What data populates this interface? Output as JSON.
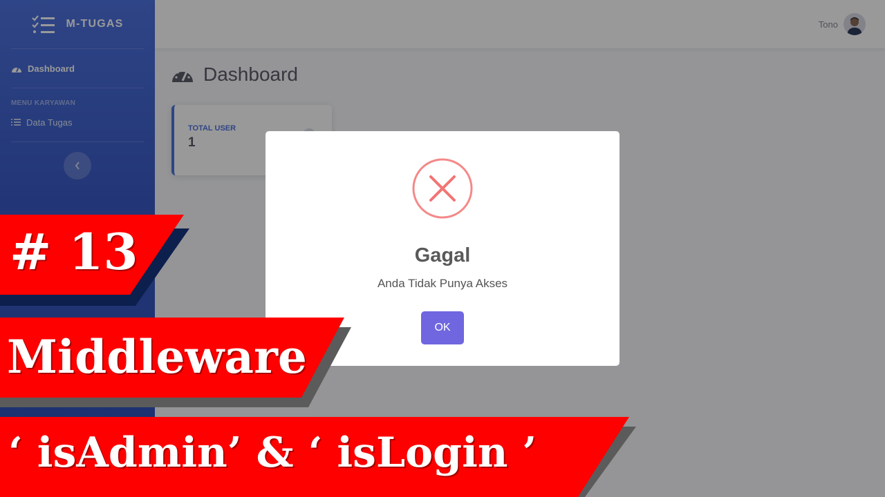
{
  "sidebar": {
    "brand_name": "M-TUGAS",
    "items": [
      {
        "label": "Dashboard",
        "icon": "tachometer-icon"
      },
      {
        "label": "Data Tugas",
        "icon": "list-icon"
      }
    ],
    "heading": "MENU KARYAWAN"
  },
  "topbar": {
    "username": "Tono"
  },
  "main": {
    "title": "Dashboard",
    "card": {
      "label": "TOTAL USER",
      "value": "1"
    }
  },
  "modal": {
    "title": "Gagal",
    "message": "Anda Tidak Punya Akses",
    "ok_label": "OK",
    "icon": "error-x-icon",
    "icon_color": "#f27474",
    "button_color": "#7066e0"
  },
  "banners": {
    "episode": "# 13",
    "topic": "Middleware",
    "subtitle": "‘ isAdmin’ & ‘ isLogin ’",
    "color": "#ff0000"
  },
  "colors": {
    "primary": "#4e73df"
  }
}
